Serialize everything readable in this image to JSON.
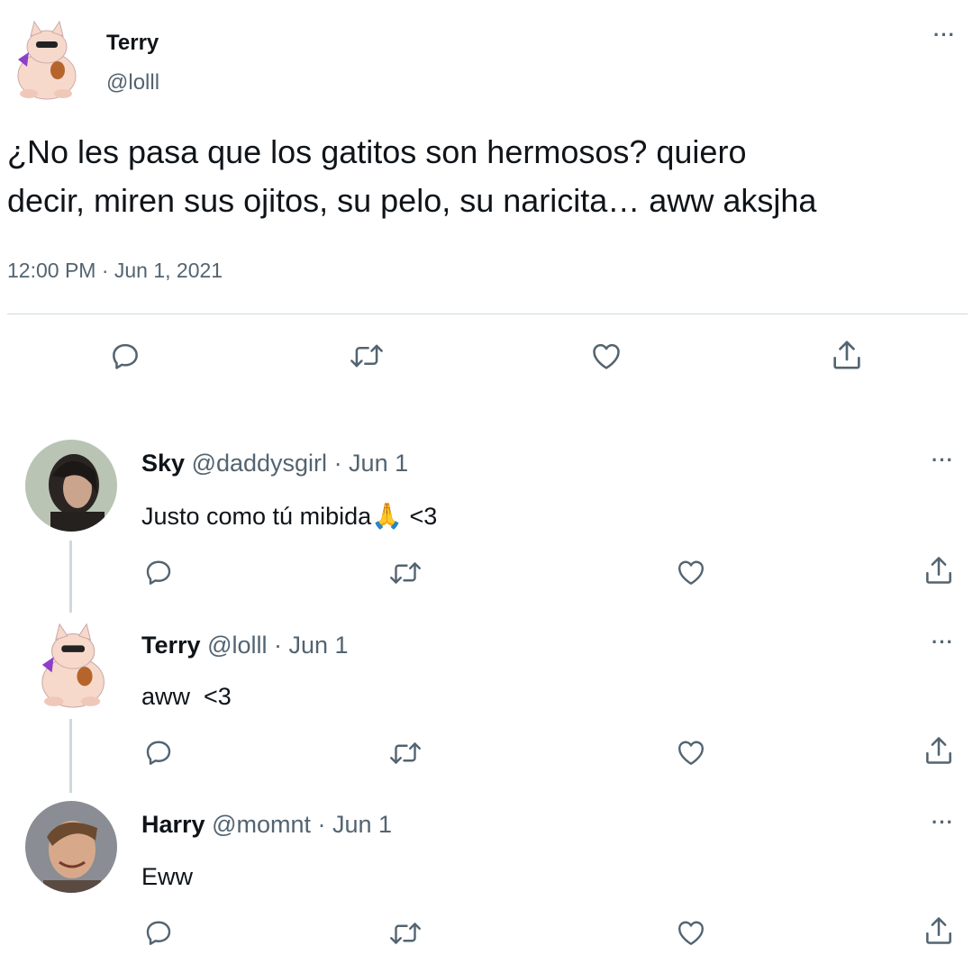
{
  "tweet": {
    "author_name": "Terry",
    "author_handle": "@lolll",
    "text": "¿No les pasa que los gatitos son hermosos? quiero decir, miren sus ojitos, su pelo, su naricita… aww aksjha",
    "text_line1": "¿No les pasa que los gatitos son hermosos? quiero",
    "text_line2": "decir, miren sus ojitos, su pelo, su naricita… aww aksjha",
    "timestamp": "12:00 PM · Jun 1, 2021",
    "more_label": "···"
  },
  "replies": [
    {
      "name": "Sky",
      "handle": "@daddysgirl",
      "date": "· Jun 1",
      "text": "Justo como tú mibida",
      "emoji": "🙏",
      "text_suffix": " <3",
      "more_label": "···"
    },
    {
      "name": "Terry",
      "handle": "@lolll",
      "date": "· Jun 1",
      "text": "aww  <3",
      "more_label": "···"
    },
    {
      "name": "Harry",
      "handle": "@momnt",
      "date": "· Jun 1",
      "text": "Eww",
      "more_label": "···"
    }
  ],
  "icons": {
    "reply": "reply-icon",
    "retweet": "retweet-icon",
    "like": "like-icon",
    "share": "share-icon",
    "more": "more-icon"
  },
  "colors": {
    "text": "#0f1419",
    "secondary": "#536471",
    "divider": "#cfd9de",
    "background": "#ffffff"
  }
}
